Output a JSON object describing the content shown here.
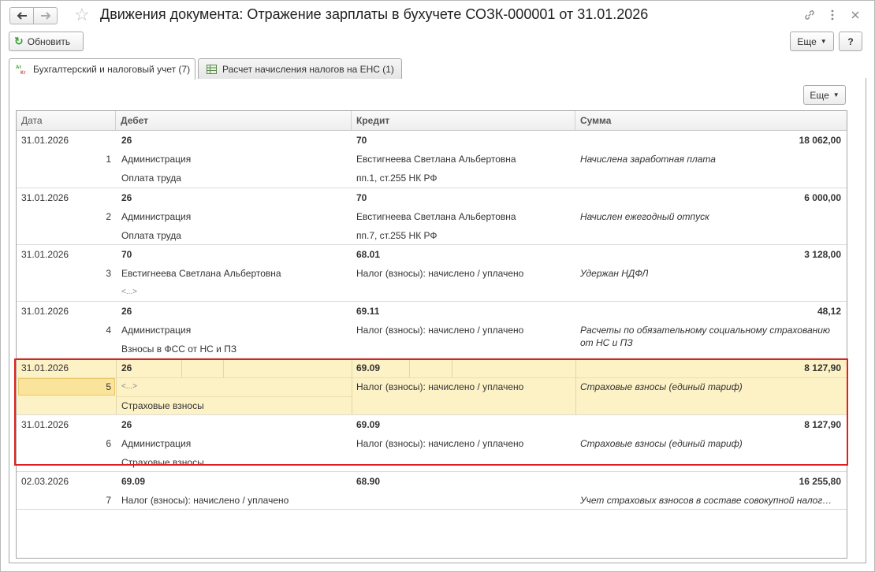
{
  "window": {
    "title": "Движения документа: Отражение зарплаты в бухучете СОЗК-000001 от 31.01.2026"
  },
  "toolbar": {
    "refresh_label": "Обновить",
    "more_label": "Еще",
    "help_label": "?"
  },
  "tabs": [
    {
      "label": "Бухгалтерский и налоговый учет (7)",
      "active": true
    },
    {
      "label": "Расчет начисления налогов на ЕНС (1)",
      "active": false
    }
  ],
  "table_more_label": "Еще",
  "table": {
    "columns": [
      "Дата",
      "Дебет",
      "Кредит",
      "Сумма"
    ],
    "rows": [
      {
        "date": "31.01.2026",
        "n": "1",
        "debit": "26",
        "debit_sub1": "Администрация",
        "debit_sub2": "Оплата труда",
        "credit": "70",
        "credit_sub1": "Евстигнеева Светлана Альбертовна",
        "credit_sub2": "пп.1, ст.255 НК РФ",
        "amount": "18 062,00",
        "content": "Начислена заработная плата",
        "content2": ""
      },
      {
        "date": "31.01.2026",
        "n": "2",
        "debit": "26",
        "debit_sub1": "Администрация",
        "debit_sub2": "Оплата труда",
        "credit": "70",
        "credit_sub1": "Евстигнеева Светлана Альбертовна",
        "credit_sub2": "пп.7, ст.255 НК РФ",
        "amount": "6 000,00",
        "content": "Начислен ежегодный отпуск",
        "content2": ""
      },
      {
        "date": "31.01.2026",
        "n": "3",
        "debit": "70",
        "debit_sub1": "Евстигнеева Светлана Альбертовна",
        "debit_sub2": "<...>",
        "credit": "68.01",
        "credit_sub1": "Налог (взносы): начислено / уплачено",
        "credit_sub2": "",
        "amount": "3 128,00",
        "content": "Удержан НДФЛ",
        "content2": ""
      },
      {
        "date": "31.01.2026",
        "n": "4",
        "debit": "26",
        "debit_sub1": "Администрация",
        "debit_sub2": "Взносы в ФСС от НС и ПЗ",
        "credit": "69.11",
        "credit_sub1": "Налог (взносы): начислено / уплачено",
        "credit_sub2": "",
        "amount": "48,12",
        "content": "Расчеты по обязательному социальному страхованию",
        "content2": "от НС и ПЗ"
      },
      {
        "date": "31.01.2026",
        "n": "5",
        "debit": "26",
        "debit_sub1": "<...>",
        "debit_sub2": "Страховые взносы",
        "credit": "69.09",
        "credit_sub1": "Налог (взносы): начислено / уплачено",
        "credit_sub2": "",
        "amount": "8 127,90",
        "content": "Страховые взносы (единый тариф)",
        "content2": ""
      },
      {
        "date": "31.01.2026",
        "n": "6",
        "debit": "26",
        "debit_sub1": "Администрация",
        "debit_sub2": "Страховые взносы",
        "credit": "69.09",
        "credit_sub1": "Налог (взносы): начислено / уплачено",
        "credit_sub2": "",
        "amount": "8 127,90",
        "content": "Страховые взносы (единый тариф)",
        "content2": ""
      },
      {
        "date": "02.03.2026",
        "n": "7",
        "debit": "69.09",
        "debit_sub1": "Налог (взносы): начислено / уплачено",
        "debit_sub2": "",
        "credit": "68.90",
        "credit_sub1": "",
        "credit_sub2": "",
        "amount": "16 255,80",
        "content": "Учет страховых взносов в составе совокупной налог…",
        "content2": ""
      }
    ]
  }
}
